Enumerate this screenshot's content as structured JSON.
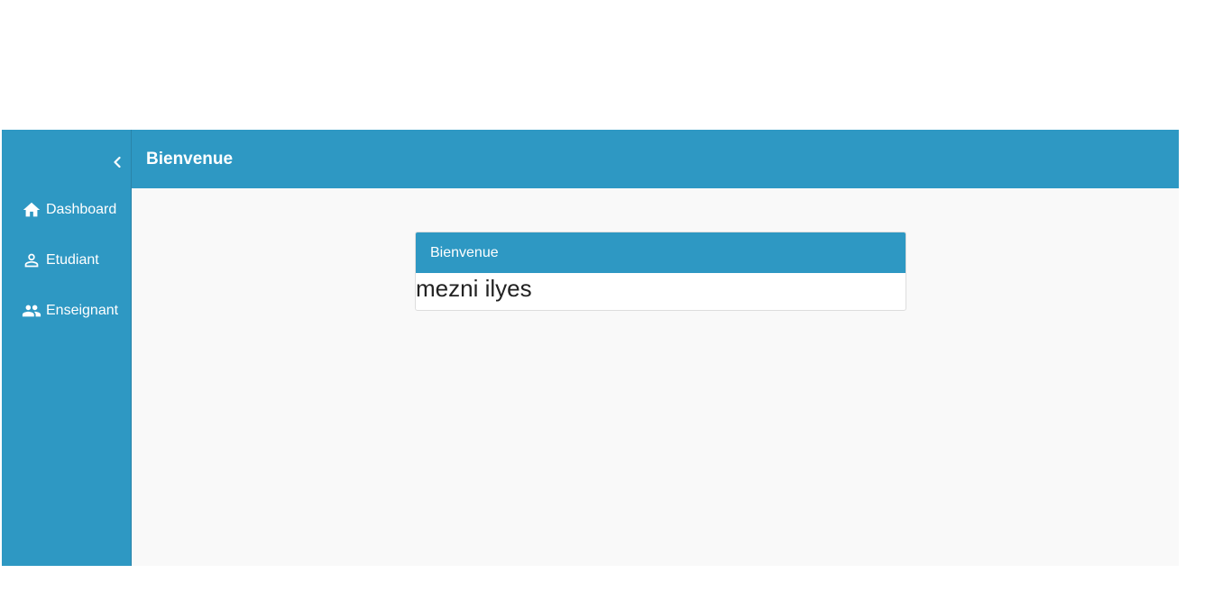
{
  "sidebar": {
    "collapse_icon": "chevron-left-icon",
    "items": [
      {
        "label": "Dashboard",
        "icon": "home-icon"
      },
      {
        "label": "Etudiant",
        "icon": "person-icon"
      },
      {
        "label": "Enseignant",
        "icon": "people-icon"
      }
    ]
  },
  "header": {
    "title": "Bienvenue"
  },
  "card": {
    "header": "Bienvenue",
    "body": "mezni ilyes"
  },
  "colors": {
    "primary": "#2e98c3",
    "content_bg": "#f9f9f9",
    "text_dark": "#222222"
  }
}
